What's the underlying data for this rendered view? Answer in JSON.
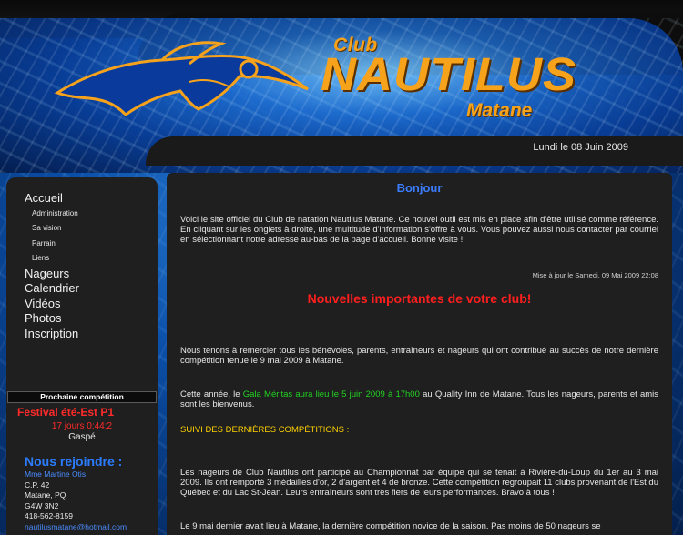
{
  "header": {
    "club": "Club",
    "name": "NAUTILUS",
    "city": "Matane",
    "date": "Lundi le 08 Juin 2009"
  },
  "menu": {
    "items": [
      {
        "label": "Accueil",
        "type": "main"
      },
      {
        "label": "Administration",
        "type": "sub"
      },
      {
        "label": "Sa vision",
        "type": "sub"
      },
      {
        "label": "Parrain",
        "type": "sub"
      },
      {
        "label": "Liens",
        "type": "sub"
      },
      {
        "label": "Nageurs",
        "type": "main"
      },
      {
        "label": "Calendrier",
        "type": "main"
      },
      {
        "label": "Vidéos",
        "type": "main"
      },
      {
        "label": "Photos",
        "type": "main"
      },
      {
        "label": "Inscription",
        "type": "main"
      }
    ]
  },
  "next_competition": {
    "heading": "Prochaine compétition",
    "event": "Festival été-Est P1",
    "countdown": "17 jours 0:44:2",
    "place": "Gaspé"
  },
  "join": {
    "heading": "Nous rejoindre :",
    "contact_name": "Mme Martine Otis",
    "address1": "C.P. 42",
    "address2": "Matane, PQ",
    "postal": "G4W 3N2",
    "phone": "418-562-8159",
    "email": "nautilusmatane@hotmail.com"
  },
  "main": {
    "greeting": "Bonjour",
    "intro": "Voici le site officiel du Club de natation Nautilus Matane. Ce nouvel outil est mis en place afin d'être utilisé comme référence.  En cliquant sur les onglets à droite, une multitude d'information s'offre à vous.  Vous pouvez aussi nous contacter par courriel en sélectionnant notre adresse au-bas de la page d'accueil. Bonne visite !",
    "updated": "Mise à jour le Samedi, 09 Mai 2009 22:08",
    "news_title": "Nouvelles importantes de votre club!",
    "thanks": "Nous tenons à remercier tous les bénévoles, parents, entraîneurs et nageurs qui ont contribué au succès de notre dernière compétition tenue le 9 mai 2009 à Matane.",
    "gala_prefix": "Cette année, le ",
    "gala_highlight": "Gala Méritas aura lieu le 5 juin 2009 à 17h00",
    "gala_suffix": " au Quality Inn de Matane.  Tous les nageurs, parents et amis sont les bienvenus.",
    "results_heading": "SUIVI DES DERNIÈRES COMPÉTITIONS :",
    "results_text": "Les nageurs de Club Nautilus ont participé au Championnat par équipe qui se tenait à Rivière-du-Loup du 1er au 3 mai 2009.  Ils ont remporté 3 médailles d'or, 2 d'argent et 4 de bronze.  Cette compétition regroupait 11 clubs provenant de l'Est du Québec et du Lac St-Jean.  Leurs entraîneurs sont très fiers de leurs performances.  Bravo à tous !",
    "novice_text": "Le 9 mai dernier avait lieu à Matane, la dernière compétition novice de la saison.  Pas moins de 50 nageurs se"
  },
  "colors": {
    "accent_orange": "#f7a21b",
    "link_blue": "#3b7dff",
    "alert_red": "#ff1f1f",
    "highlight_green": "#22d322",
    "heading_yellow": "#ffd200",
    "panel_dark": "#1f1f1f"
  }
}
